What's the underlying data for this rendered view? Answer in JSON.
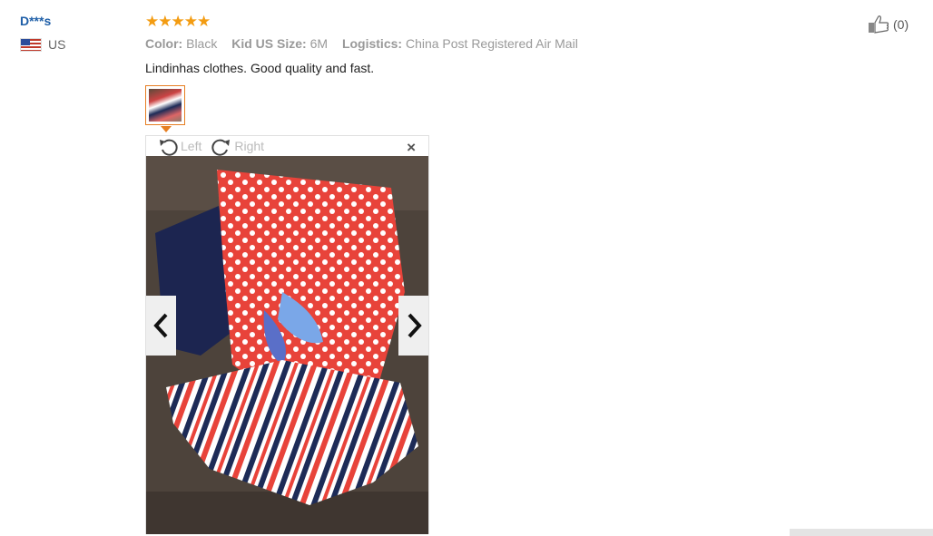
{
  "reviewer": {
    "name": "D***s",
    "country": "US",
    "flag_icon": "us-flag-icon"
  },
  "review": {
    "rating": 5,
    "stars_text": "★★★★★",
    "color_key": "Color:",
    "color_value": "Black",
    "size_key": "Kid US Size:",
    "size_value": "6M",
    "logistics_key": "Logistics:",
    "logistics_value": "China Post Registered Air Mail",
    "text": "Lindinhas clothes. Good quality and fast."
  },
  "viewer": {
    "rotate_left_label": "Left",
    "rotate_right_label": "Right",
    "close_label": "×",
    "prev_icon": "chevron-left-icon",
    "next_icon": "chevron-right-icon"
  },
  "helpful": {
    "icon": "thumbs-up-icon",
    "count": "(0)"
  },
  "colors": {
    "accent": "#e67e22",
    "star": "#f39c12",
    "name": "#1f5fa8"
  }
}
